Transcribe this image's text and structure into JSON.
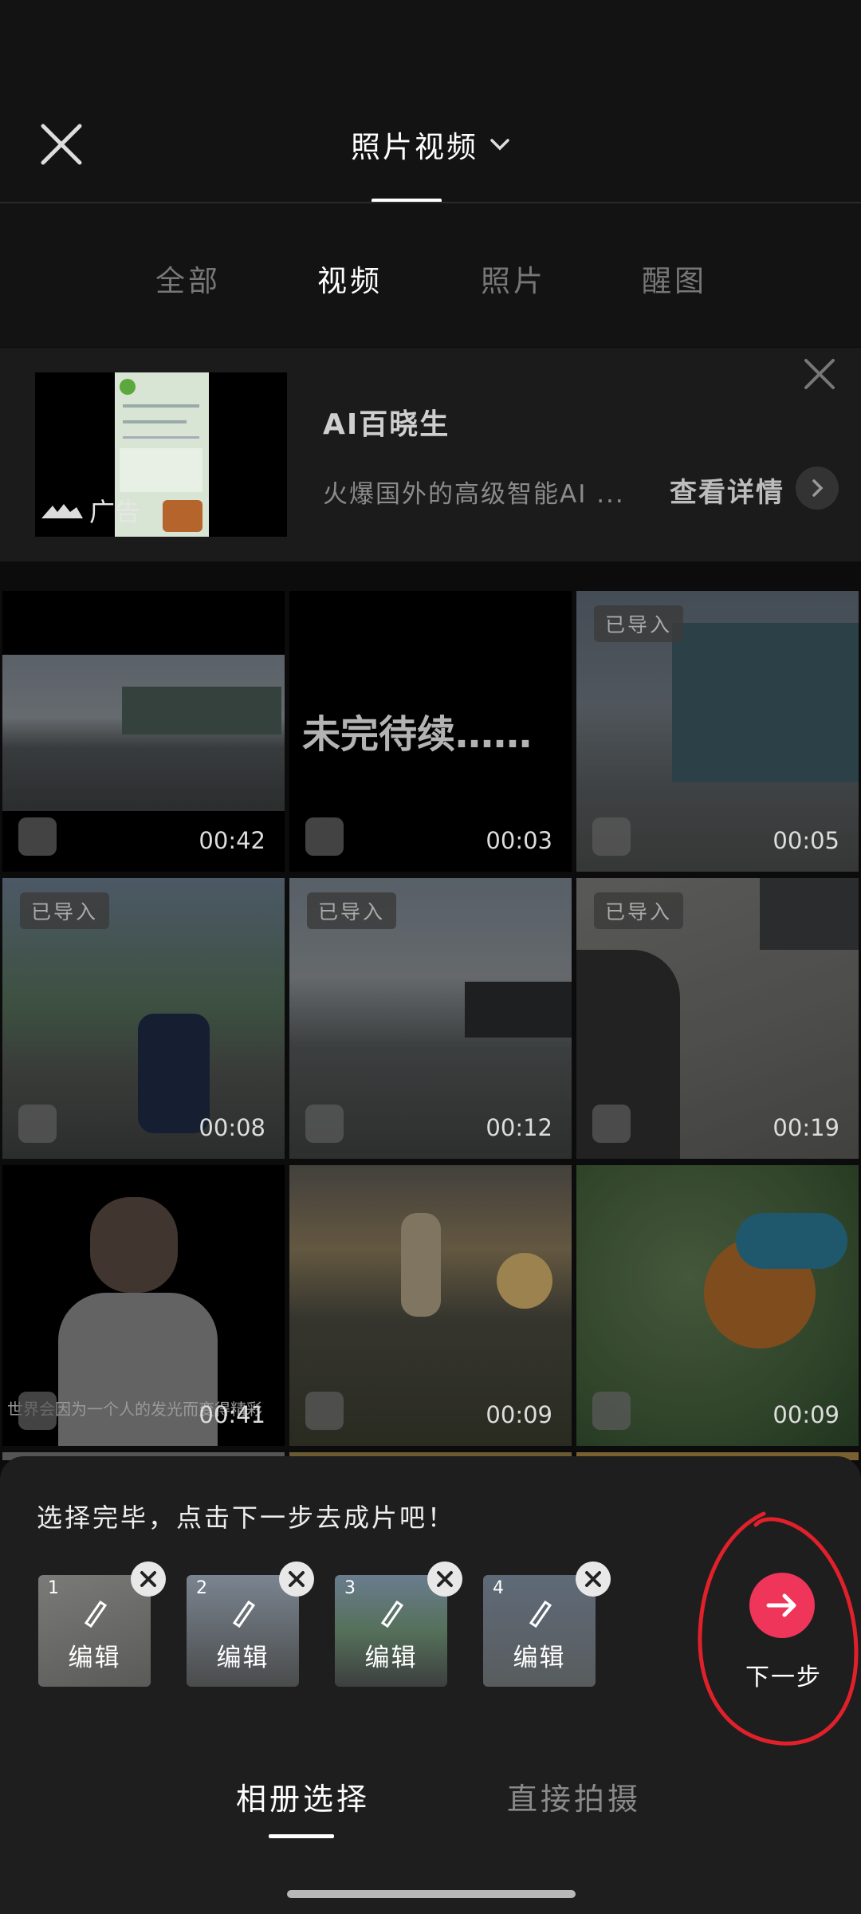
{
  "header": {
    "title": "照片视频"
  },
  "filters": [
    "全部",
    "视频",
    "照片",
    "醒图"
  ],
  "ad": {
    "label": "广告",
    "title": "AI百晓生",
    "description": "火爆国外的高级智能AI ...",
    "detail_label": "查看详情"
  },
  "grid": {
    "imported_badge": "已导入",
    "tiles": [
      {
        "duration": "00:42"
      },
      {
        "duration": "00:03",
        "overlay_text": "未完待续……"
      },
      {
        "duration": "00:05"
      },
      {
        "duration": "00:08"
      },
      {
        "duration": "00:12"
      },
      {
        "duration": "00:19"
      },
      {
        "duration": "00:41",
        "caption": "世界会因为一个人的发光而变得精彩"
      },
      {
        "duration": "00:09"
      },
      {
        "duration": "00:09"
      }
    ]
  },
  "panel": {
    "hint": "选择完毕，点击下一步去成片吧！",
    "edit_label": "编辑",
    "selected": [
      {
        "index": "1"
      },
      {
        "index": "2"
      },
      {
        "index": "3"
      },
      {
        "index": "4"
      }
    ],
    "next_label": "下一步"
  },
  "bottom_tabs": [
    "相册选择",
    "直接拍摄"
  ],
  "colors": {
    "accent": "#f0355a",
    "annotation": "#e0202a"
  }
}
